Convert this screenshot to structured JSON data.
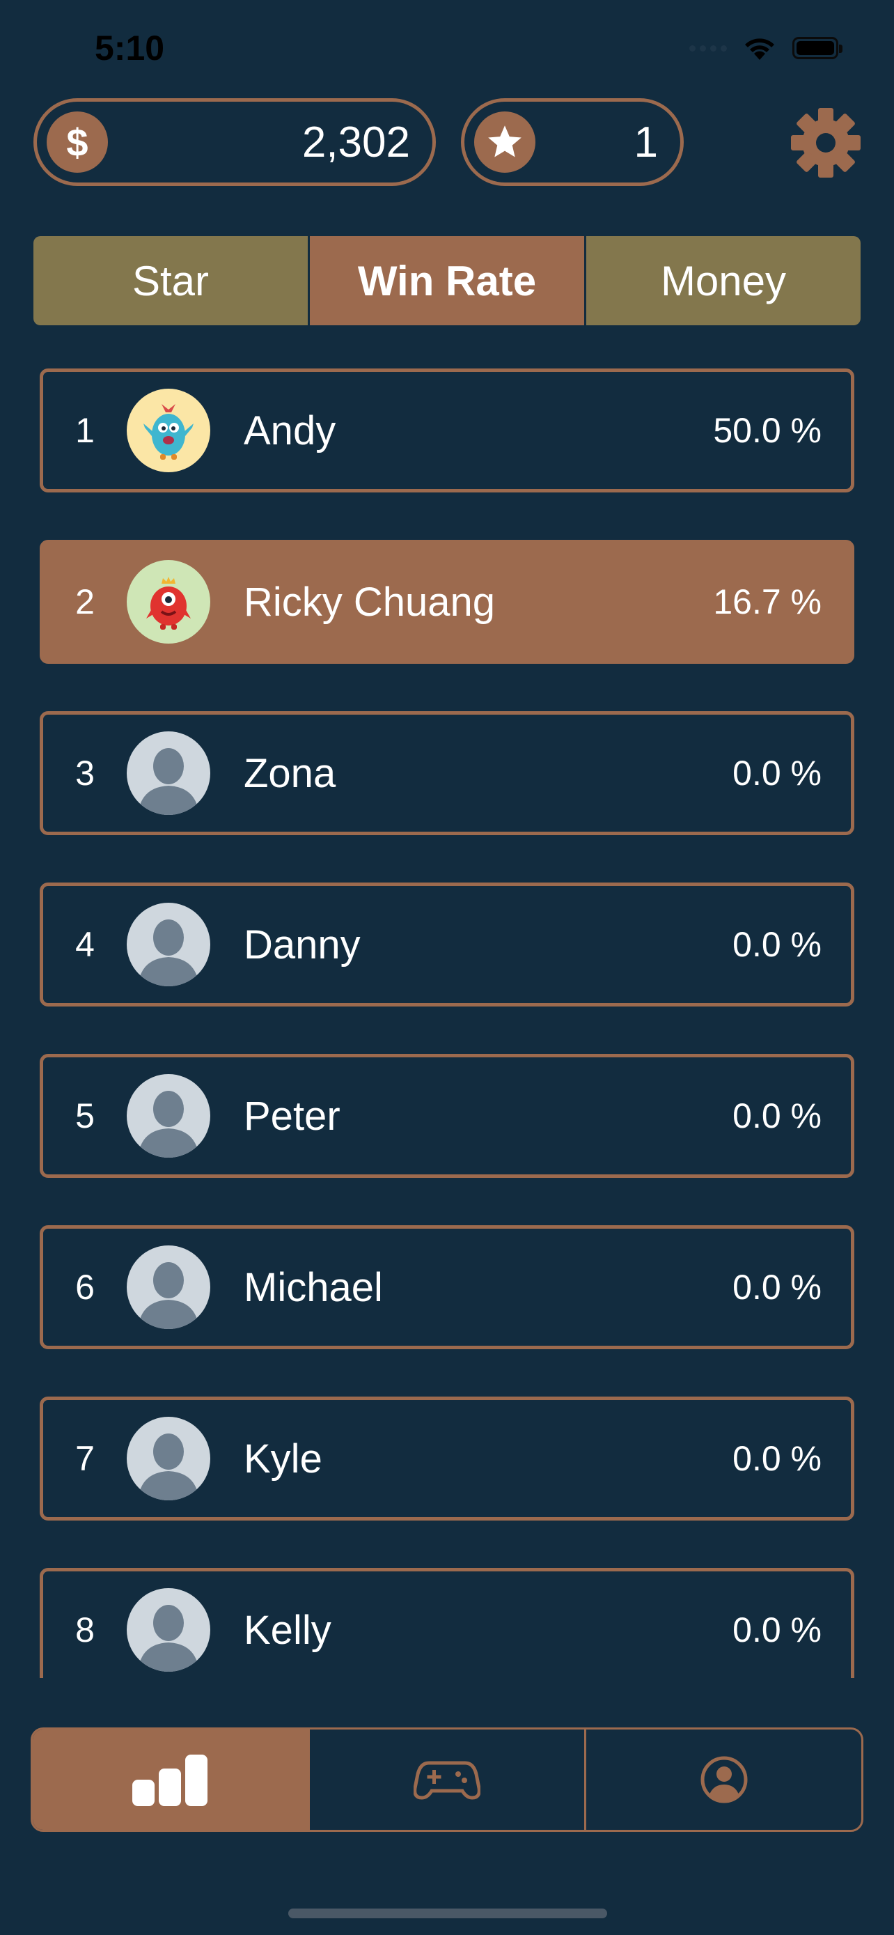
{
  "status_bar": {
    "time": "5:10"
  },
  "header": {
    "money": {
      "icon": "dollar-icon",
      "symbol": "$",
      "value": "2,302"
    },
    "stars": {
      "icon": "star-icon",
      "value": "1"
    },
    "settings_icon": "gear-icon"
  },
  "tabs": [
    {
      "label": "Star",
      "active": false
    },
    {
      "label": "Win Rate",
      "active": true
    },
    {
      "label": "Money",
      "active": false
    }
  ],
  "leaderboard": [
    {
      "rank": "1",
      "name": "Andy",
      "rate": "50.0 %",
      "avatar": "blue-monster",
      "highlighted": false
    },
    {
      "rank": "2",
      "name": "Ricky Chuang",
      "rate": "16.7 %",
      "avatar": "red-monster",
      "highlighted": true
    },
    {
      "rank": "3",
      "name": "Zona",
      "rate": "0.0 %",
      "avatar": "default-person",
      "highlighted": false
    },
    {
      "rank": "4",
      "name": "Danny",
      "rate": "0.0 %",
      "avatar": "default-person",
      "highlighted": false
    },
    {
      "rank": "5",
      "name": "Peter",
      "rate": "0.0 %",
      "avatar": "default-person",
      "highlighted": false
    },
    {
      "rank": "6",
      "name": "Michael",
      "rate": "0.0 %",
      "avatar": "default-person",
      "highlighted": false
    },
    {
      "rank": "7",
      "name": "Kyle",
      "rate": "0.0 %",
      "avatar": "default-person",
      "highlighted": false
    },
    {
      "rank": "8",
      "name": "Kelly",
      "rate": "0.0 %",
      "avatar": "default-person",
      "highlighted": false
    }
  ],
  "tab_bar": [
    {
      "icon": "leaderboard-icon",
      "active": true
    },
    {
      "icon": "gamepad-icon",
      "active": false
    },
    {
      "icon": "profile-icon",
      "active": false
    }
  ],
  "colors": {
    "background": "#122c3f",
    "accent": "#9c6a4e",
    "tab_inactive": "#83774d"
  }
}
